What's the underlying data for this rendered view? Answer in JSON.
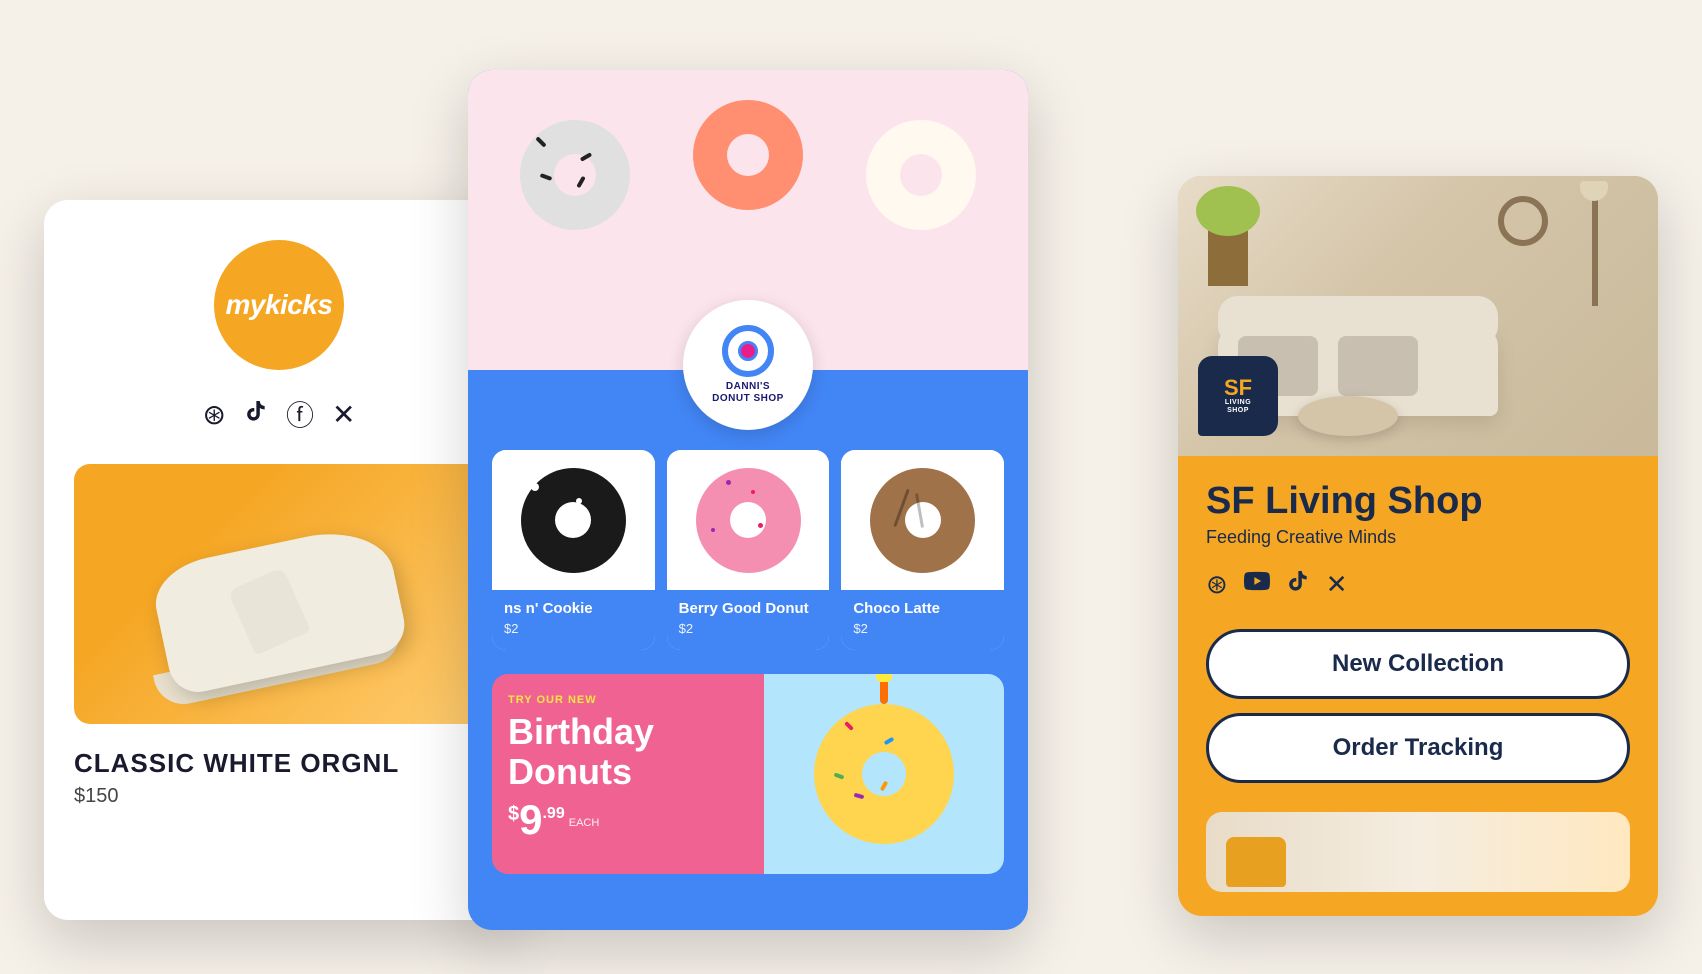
{
  "mykicks": {
    "logo_text": "mykicks",
    "social_icons": [
      "instagram",
      "tiktok",
      "facebook",
      "x-twitter"
    ],
    "product_title": "CLASSIC WHITE ORGNL",
    "product_price": "$150"
  },
  "donut": {
    "logo_name": "DANNI'S",
    "logo_subtitle": "DONUT SHOP",
    "items": [
      {
        "name": "n's n' Cookie",
        "price": "$2",
        "color": "#333"
      },
      {
        "name": "Berry Good Donut",
        "price": "$2",
        "color": "#e91e8c"
      },
      {
        "name": "Choco Latte",
        "price": "$2",
        "color": "#795548"
      }
    ],
    "promo_tag": "TRY OUR NEW",
    "promo_title": "Birthday\nDonuts",
    "promo_price": "$9.99",
    "promo_each": "EACH"
  },
  "sf": {
    "logo_text": "SF",
    "logo_sub": "LIVING\nSHOP",
    "shop_name": "SF Living Shop",
    "tagline": "Feeding Creative Minds",
    "social_icons": [
      "instagram",
      "youtube",
      "tiktok",
      "x-twitter"
    ],
    "button_new_collection": "New Collection",
    "button_order_tracking": "Order Tracking"
  }
}
